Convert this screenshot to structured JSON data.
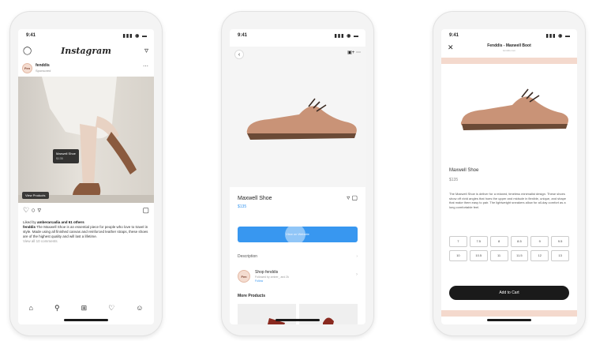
{
  "phone_feed": {
    "time": "9:41",
    "signal": "▮▮▮ ◉ ▬",
    "app_title": "Instagram",
    "post": {
      "account": "fenddis",
      "sublabel": "Sponsored",
      "avatar_initials": "Fen",
      "tag_title": "Maxwell Shoe",
      "tag_price": "$135",
      "view_products": "View Products",
      "liked_by_prefix": "Liked by ",
      "liked_by_user": "amberarcadia",
      "liked_by_suffix": " and 61 others",
      "caption_user": "fenddis",
      "caption_text": " The Maxwell Shoe is an essential piece for people who love to travel in style. Made using all finished canvas and reinforced leather straps, these shoes are of the highest quality and will last a lifetime.",
      "view_comments": "View all 10 comments"
    }
  },
  "phone_product": {
    "time": "9:41",
    "signal": "▮▮▮ ◉ ▬",
    "product_name": "Maxwell Shoe",
    "product_price": "$135",
    "cta_label": "View on Website",
    "description_label": "Description",
    "shop_name": "Shop fenddis",
    "shop_followers": "Followed by amber_ and 2k",
    "shop_follow": "Follow",
    "avatar_initials": "Fen",
    "more_products_label": "More Products"
  },
  "phone_checkout": {
    "time": "9:41",
    "signal": "▮▮▮ ◉ ▬",
    "header_title": "Fenddis - Maxwell Boot",
    "header_sub": "fenddis.com",
    "product_name": "Maxwell Shoe",
    "product_price": "$135",
    "description": "The Maxwell Shoe is deliver for a relaxed, timeless minimalist design. These shoes show off vivid angles that hoes the upper and midsole in flexible, unique, and shape that make them easy to pair. The lightweight sneakers allow for all-day comfort as a long comfortable feel.",
    "sizes": [
      "7",
      "7.5",
      "8",
      "8.5",
      "9",
      "9.5",
      "10",
      "10.5",
      "11",
      "11.5",
      "12",
      "13"
    ],
    "add_to_cart": "Add to Cart"
  },
  "colors": {
    "ig_blue": "#3897f0",
    "peach": "#f4d9cd",
    "shoe": "#c99377"
  }
}
